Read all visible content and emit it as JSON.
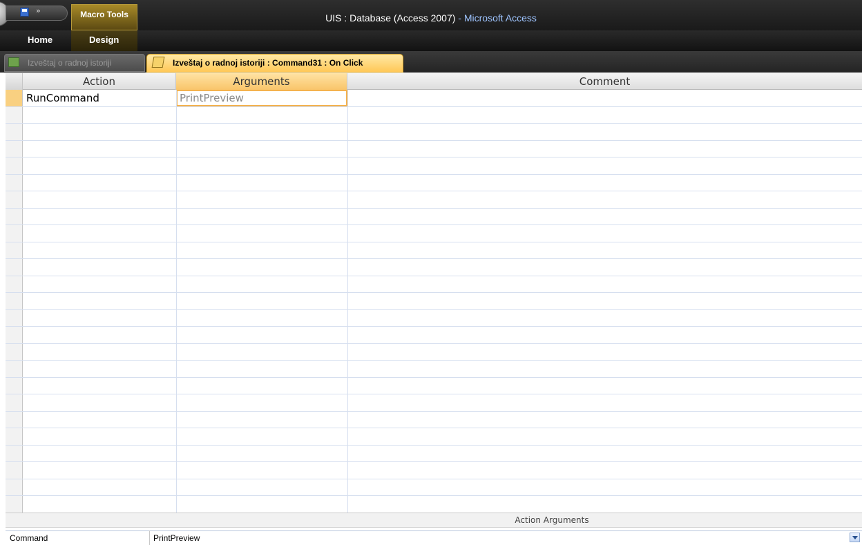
{
  "window": {
    "title_document": "UIS : Database (Access 2007)",
    "title_separator": "-",
    "title_app": "Microsoft Access"
  },
  "quick_access": {
    "more_label": "»"
  },
  "contextual_group": {
    "label": "Macro Tools"
  },
  "ribbon_tabs": [
    {
      "label": "Home"
    },
    {
      "label": "Design"
    }
  ],
  "document_tabs": [
    {
      "label": "Izveštaj o radnoj istoriji",
      "active": false,
      "icon": "report-icon"
    },
    {
      "label": "Izveštaj o radnoj istoriji : Command31 : On Click",
      "active": true,
      "icon": "macro-icon"
    }
  ],
  "grid": {
    "columns": [
      {
        "label": "Action"
      },
      {
        "label": "Arguments"
      },
      {
        "label": "Comment"
      }
    ],
    "rows": [
      {
        "action": "RunCommand",
        "arguments": "PrintPreview",
        "comment": ""
      }
    ]
  },
  "action_arguments": {
    "title": "Action Arguments",
    "fields": [
      {
        "label": "Command",
        "value": "PrintPreview"
      }
    ]
  },
  "colors": {
    "accent": "#f9c56a",
    "title_app": "#9ec4ff",
    "contextual": "#a88a28"
  }
}
